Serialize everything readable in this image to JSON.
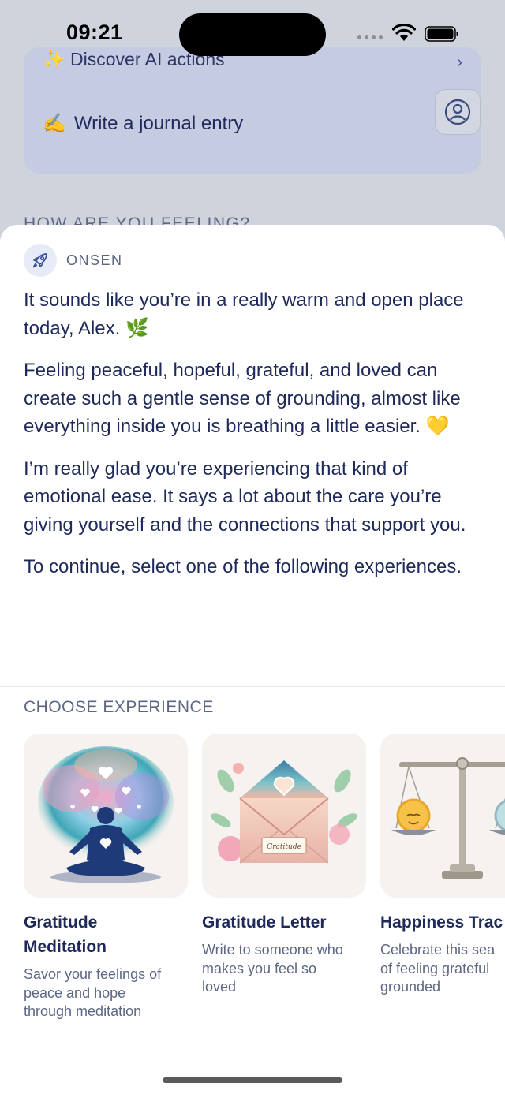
{
  "status_bar": {
    "time": "09:21"
  },
  "background": {
    "card_top_label": "✨ Discover AI actions",
    "journal_icon": "✍️",
    "journal_label": "Write a journal entry",
    "section_label": "HOW ARE YOU FEELING?"
  },
  "sheet": {
    "sender": "ONSEN",
    "paragraphs": [
      "It sounds like you’re in a really warm and open place today, Alex. 🌿",
      "Feeling peaceful, hopeful, grateful, and loved can create such a gentle sense of grounding, almost like everything inside you is breathing a little easier. 💛",
      "I’m really glad you’re experiencing that kind of emotional ease. It says a lot about the care you’re giving yourself and the connections that support you.",
      "To continue, select one of the following experiences."
    ],
    "choose_label": "CHOOSE EXPERIENCE",
    "experiences": [
      {
        "title": "Gratitude Meditation",
        "title_line1": "Gratitude",
        "title_line2": "Meditation",
        "desc_line1": "Savor your feelings of",
        "desc_line2": "peace and hope",
        "desc_line3": "through meditation"
      },
      {
        "title": "Gratitude Letter",
        "envelope_label": "Gratitude",
        "desc_line1": "Write to someone who",
        "desc_line2": "makes you feel so",
        "desc_line3": "loved"
      },
      {
        "title": "Happiness Trac",
        "desc_line1": "Celebrate this sea",
        "desc_line2": "of feeling grateful",
        "desc_line3": "grounded"
      }
    ]
  },
  "colors": {
    "text_primary": "#1f2a5a",
    "text_secondary": "#5d6784",
    "accent": "#3a4fa0",
    "sheet_bg": "#ffffff"
  }
}
